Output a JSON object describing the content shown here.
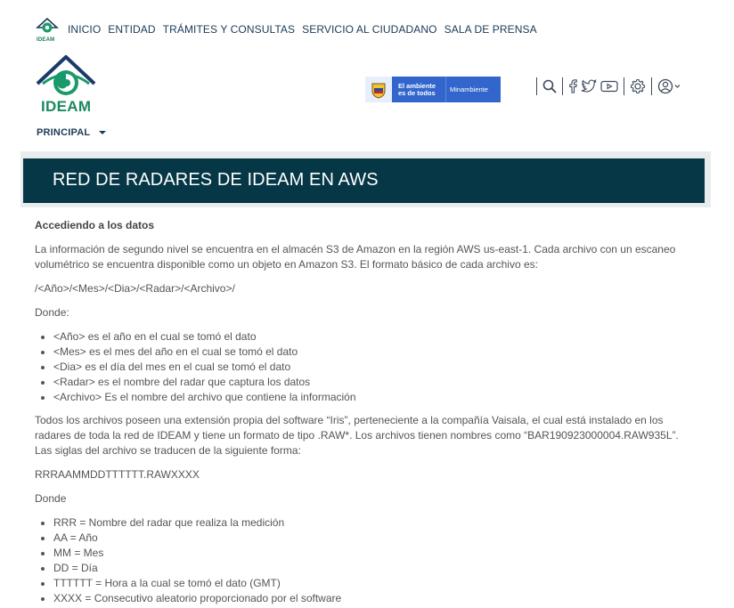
{
  "topnav": {
    "logo_text": "IDEAM",
    "links": [
      "INICIO",
      "ENTIDAD",
      "TRÁMITES Y CONSULTAS",
      "SERVICIO AL CIUDADANO",
      "SALA DE PRENSA"
    ]
  },
  "header": {
    "logo_text": "IDEAM",
    "gov_slogan_line1": "El ambiente",
    "gov_slogan_line2": "es de todos",
    "gov_ministry": "Minambiente",
    "tool_icons": [
      "search-icon",
      "facebook-icon",
      "twitter-icon",
      "youtube-icon",
      "gear-icon",
      "user-icon"
    ],
    "menu_label": "PRINCIPAL"
  },
  "banner": {
    "title": "RED DE RADARES DE IDEAM EN AWS"
  },
  "content": {
    "heading": "Accediendo a los datos",
    "intro": "La información de segundo nivel se encuentra en el almacén S3 de Amazon en la región AWS us-east-1. Cada archivo con un escaneo volumétrico se encuentra disponible como un objeto en Amazon S3. El formato básico de cada archivo es:",
    "path_format": "/<Año>/<Mes>/<Dia>/<Radar>/<Archivo>/",
    "donde1": "Donde:",
    "list1": [
      "<Año> es el año en el cual se tomó el dato",
      "<Mes> es el mes del año en el cual se tomó el dato",
      "<Dia> es el día del mes en el cual se tomó el dato",
      "<Radar> es el nombre del radar que captura los datos",
      "<Archivo> Es el nombre del archivo que contiene la información"
    ],
    "para2": "Todos los archivos poseen una extensión propia del software “Iris”, perteneciente a la compañía Vaisala, el cual está instalado en los radares de toda la red de IDEAM y tiene un formato de tipo .RAW*. Los archivos tienen nombres como “BAR190923000004.RAW935L”. Las siglas del archivo se traducen de la siguiente forma:",
    "name_format": "RRRAAMMDDTTTTTT.RAWXXXX",
    "donde2": "Donde",
    "list2": [
      "RRR = Nombre del radar que realiza la medición",
      "AA = Año",
      "MM = Mes",
      "DD = Día",
      "TTTTTT = Hora a la cual se tomó el dato (GMT)",
      "XXXX = Consecutivo aleatorio proporcionado por el software"
    ]
  },
  "colors": {
    "banner_bg": "#063746",
    "nav_text": "#1b3a57",
    "gov_blue": "#3366cc",
    "ideam_green": "#1a8a5e"
  }
}
